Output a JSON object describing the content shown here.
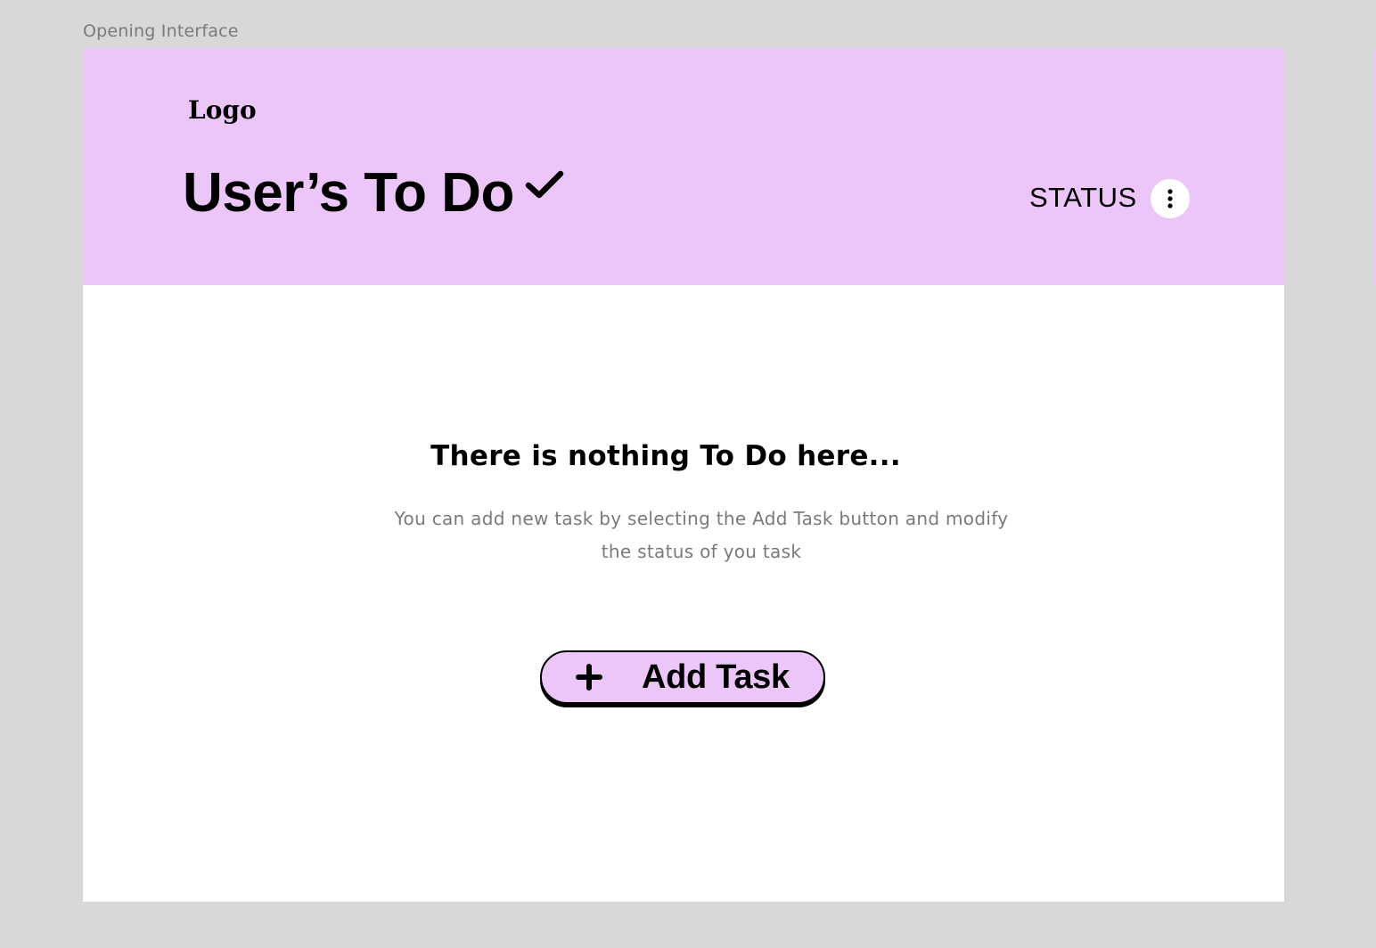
{
  "canvas": {
    "frame_label": "Opening Interface"
  },
  "header": {
    "logo": "Logo",
    "title": "User’s To Do",
    "status_label": "STATUS",
    "background_color": "#ecc6f8",
    "check_icon": "checkmark-icon",
    "menu_icon": "vertical-dots-icon"
  },
  "empty_state": {
    "title": "There is nothing To Do here...",
    "description": "You can add new task by selecting the Add Task button and modify the status of you task"
  },
  "add_task_button": {
    "label": "Add Task",
    "icon": "plus-icon",
    "color": "#ecc6f8"
  }
}
